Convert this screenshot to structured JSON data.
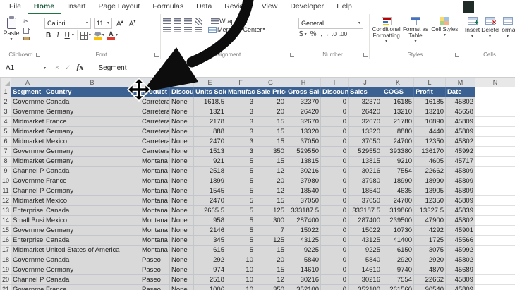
{
  "tabs": {
    "items": [
      "File",
      "Home",
      "Insert",
      "Page Layout",
      "Formulas",
      "Data",
      "Review",
      "View",
      "Developer",
      "Help"
    ],
    "active": "Home"
  },
  "ribbon": {
    "groups": {
      "clipboard": "Clipboard",
      "font": "Font",
      "alignment": "Alignment",
      "number": "Number",
      "styles": "Styles",
      "cells": "Cells"
    },
    "clipboard": {
      "paste": "Paste"
    },
    "font": {
      "name": "Calibri",
      "size": "11",
      "bold": "B",
      "italic": "I",
      "underline": "U",
      "grow_font": "A",
      "shrink_font": "A",
      "font_color": "A"
    },
    "alignment": {
      "wrap": "Wrap Text",
      "merge": "Merge & Center"
    },
    "number": {
      "format": "General",
      "accounting": "$",
      "percent": "%",
      "comma": ",",
      "increase_decimal": "←.0",
      "decrease_decimal": ".00→"
    },
    "styles": {
      "conditional": "Conditional Formatting",
      "format_table": "Format as Table",
      "cell_styles": "Cell Styles"
    },
    "cells": {
      "insert": "Insert",
      "delete": "Delete",
      "format": "Format"
    }
  },
  "formula_bar": {
    "name_box": "A1",
    "fx": "fx",
    "content": "Segment"
  },
  "icons": {
    "chevron_down": "▾",
    "cut": "✂",
    "cancel": "×",
    "enter": "✓"
  },
  "sheet": {
    "column_letters": [
      "A",
      "B",
      "C",
      "D",
      "E",
      "F",
      "G",
      "H",
      "I",
      "J",
      "K",
      "L",
      "M",
      "N"
    ],
    "header_row": [
      "Segment",
      "Country",
      "Product",
      "Discount Band",
      "Units Sold",
      "Manufacturing",
      "Sale Price",
      "Gross Sales",
      "Discounts",
      "Sales",
      "COGS",
      "Profit",
      "Date"
    ],
    "rows": [
      [
        "Government",
        "Canada",
        "Carretera",
        "None",
        "1618.5",
        "3",
        "20",
        "32370",
        "0",
        "32370",
        "16185",
        "16185",
        "45802"
      ],
      [
        "Government",
        "Germany",
        "Carretera",
        "None",
        "1321",
        "3",
        "20",
        "26420",
        "0",
        "26420",
        "13210",
        "13210",
        "45658"
      ],
      [
        "Midmarket",
        "France",
        "Carretera",
        "None",
        "2178",
        "3",
        "15",
        "32670",
        "0",
        "32670",
        "21780",
        "10890",
        "45809"
      ],
      [
        "Midmarket",
        "Germany",
        "Carretera",
        "None",
        "888",
        "3",
        "15",
        "13320",
        "0",
        "13320",
        "8880",
        "4440",
        "45809"
      ],
      [
        "Midmarket",
        "Mexico",
        "Carretera",
        "None",
        "2470",
        "3",
        "15",
        "37050",
        "0",
        "37050",
        "24700",
        "12350",
        "45802"
      ],
      [
        "Government",
        "Germany",
        "Carretera",
        "None",
        "1513",
        "3",
        "350",
        "529550",
        "0",
        "529550",
        "393380",
        "136170",
        "45992"
      ],
      [
        "Midmarket",
        "Germany",
        "Montana",
        "None",
        "921",
        "5",
        "15",
        "13815",
        "0",
        "13815",
        "9210",
        "4605",
        "45717"
      ],
      [
        "Channel Partners",
        "Canada",
        "Montana",
        "None",
        "2518",
        "5",
        "12",
        "30216",
        "0",
        "30216",
        "7554",
        "22662",
        "45809"
      ],
      [
        "Government",
        "France",
        "Montana",
        "None",
        "1899",
        "5",
        "20",
        "37980",
        "0",
        "37980",
        "18990",
        "18990",
        "45809"
      ],
      [
        "Channel Partners",
        "Germany",
        "Montana",
        "None",
        "1545",
        "5",
        "12",
        "18540",
        "0",
        "18540",
        "4635",
        "13905",
        "45809"
      ],
      [
        "Midmarket",
        "Mexico",
        "Montana",
        "None",
        "2470",
        "5",
        "15",
        "37050",
        "0",
        "37050",
        "24700",
        "12350",
        "45809"
      ],
      [
        "Enterprise",
        "Canada",
        "Montana",
        "None",
        "2665.5",
        "5",
        "125",
        "333187.5",
        "0",
        "333187.5",
        "319860",
        "13327.5",
        "45839"
      ],
      [
        "Small Business",
        "Mexico",
        "Montana",
        "None",
        "958",
        "5",
        "300",
        "287400",
        "0",
        "287400",
        "239500",
        "47900",
        "45802"
      ],
      [
        "Government",
        "Germany",
        "Montana",
        "None",
        "2146",
        "5",
        "7",
        "15022",
        "0",
        "15022",
        "10730",
        "4292",
        "45901"
      ],
      [
        "Enterprise",
        "Canada",
        "Montana",
        "None",
        "345",
        "5",
        "125",
        "43125",
        "0",
        "43125",
        "41400",
        "1725",
        "45566"
      ],
      [
        "Midmarket",
        "United States of America",
        "Montana",
        "None",
        "615",
        "5",
        "15",
        "9225",
        "0",
        "9225",
        "6150",
        "3075",
        "45992"
      ],
      [
        "Government",
        "Canada",
        "Paseo",
        "None",
        "292",
        "10",
        "20",
        "5840",
        "0",
        "5840",
        "2920",
        "2920",
        "45802"
      ],
      [
        "Government",
        "Germany",
        "Paseo",
        "None",
        "974",
        "10",
        "15",
        "14610",
        "0",
        "14610",
        "9740",
        "4870",
        "45689"
      ],
      [
        "Channel Partners",
        "Canada",
        "Paseo",
        "None",
        "2518",
        "10",
        "12",
        "30216",
        "0",
        "30216",
        "7554",
        "22662",
        "45809"
      ],
      [
        "Government",
        "France",
        "Paseo",
        "None",
        "1006",
        "10",
        "350",
        "352100",
        "0",
        "352100",
        "261560",
        "90540",
        "45809"
      ]
    ]
  },
  "colors": {
    "header_fill": "#3a6191",
    "selection_fill": "#d9d9d9",
    "accent_green": "#217346",
    "annotation": "#0d0d0d"
  }
}
